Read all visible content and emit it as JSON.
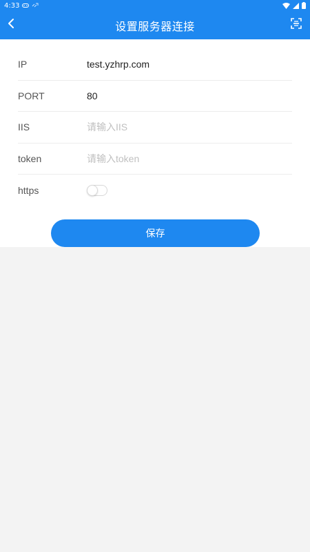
{
  "status_bar": {
    "time": "4:33"
  },
  "header": {
    "title": "设置服务器连接",
    "back_icon": "chevron-left-icon",
    "scan_icon": "scan-icon"
  },
  "form": {
    "ip": {
      "label": "IP",
      "value": "test.yzhrp.com",
      "placeholder": ""
    },
    "port": {
      "label": "PORT",
      "value": "80",
      "placeholder": ""
    },
    "iis": {
      "label": "IIS",
      "value": "",
      "placeholder": "请输入IIS"
    },
    "token": {
      "label": "token",
      "value": "",
      "placeholder": "请输入token"
    },
    "https": {
      "label": "https",
      "enabled": false
    }
  },
  "actions": {
    "save_label": "保存"
  },
  "colors": {
    "primary": "#1e88f0",
    "background": "#f3f3f3",
    "card": "#ffffff"
  }
}
